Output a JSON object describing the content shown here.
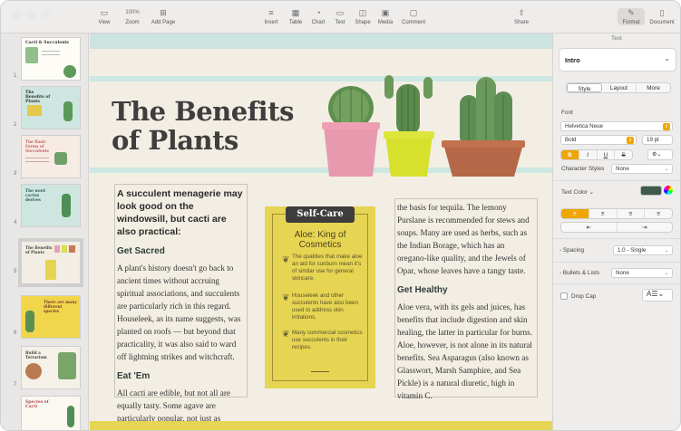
{
  "toolbar": {
    "view": "View",
    "zoom_value": "100%",
    "zoom": "Zoom",
    "add_page": "Add Page",
    "insert": "Insert",
    "table": "Table",
    "chart": "Chart",
    "text": "Text",
    "shape": "Shape",
    "media": "Media",
    "comment": "Comment",
    "share": "Share",
    "format": "Format",
    "document": "Document"
  },
  "sidebar": {
    "thumbnails": [
      {
        "num": "1",
        "title": "Cacti & Succulents"
      },
      {
        "num": "2",
        "title": "The Benefits of Plants"
      },
      {
        "num": "3",
        "title": "The Basic Forms of Succulents"
      },
      {
        "num": "4",
        "title": "The word cactus derives"
      },
      {
        "num": "5",
        "title": "The Benefits of Plants"
      },
      {
        "num": "6",
        "title": "There are many different species"
      },
      {
        "num": "7",
        "title": "Build a Terrarium"
      },
      {
        "num": "8",
        "title": "Species of Cacti"
      }
    ]
  },
  "page": {
    "title_line1": "The Benefits",
    "title_line2": "of Plants",
    "lead": "A succulent menagerie may look good on the windowsill, but cacti are also practical:",
    "h_sacred": "Get Sacred",
    "p_sacred": "A plant's history doesn't go back to ancient times without accruing spiritual associations, and succulents are particularly rich in this regard. Houseleek, as its name suggests, was planted on roofs — but beyond that practicality, it was also said to ward off lightning strikes and witchcraft.",
    "h_eat": "Eat 'Em",
    "p_eat": "All cacti are edible, but not all are equally tasty. Some agave are particularly popular, not just as ingredients in cooking but as",
    "selfcare_badge": "Self-Care",
    "selfcare_title": "Aloe: King of Cosmetics",
    "selfcare_items": [
      "The qualities that make aloe an aid for sunburn mean it's of similar use for general skincare.",
      "Houseleek and other succulents have also been used to address skin irritations.",
      "Many commercial cosmetics use succulents in their recipes."
    ],
    "p_right1": "the basis for tequila. The lemony Purslane is recommended for stews and soups. Many are used as herbs, such as the Indian Borage, which has an oregano-like quality, and the Jewels of Opar, whose leaves have a tangy taste.",
    "h_healthy": "Get Healthy",
    "p_healthy": "Aloe vera, with its gels and juices, has benefits that include digestion and skin healing, the latter in particular for burns. Aloe, however, is not alone in its natural benefits. Sea Asparagus (also known as Glasswort, Marsh Samphire, and Sea Pickle) is a natural diuretic, high in vitamin C."
  },
  "inspector": {
    "header": "Text",
    "style_name": "Intro",
    "tabs": [
      "Style",
      "Layout",
      "More"
    ],
    "font_label": "Font",
    "font_name": "Helvetica Neue",
    "font_weight": "Bold",
    "font_size": "19 pt",
    "styles": [
      "B",
      "I",
      "U",
      "S"
    ],
    "char_styles_label": "Character Styles",
    "char_styles_value": "None",
    "text_color_label": "Text Color",
    "spacing_label": "Spacing",
    "spacing_value": "1.0 - Single",
    "bullets_label": "Bullets & Lists",
    "bullets_value": "None",
    "dropcap_label": "Drop Cap",
    "text_color": "#3f5a4a",
    "accent": "#f0a500"
  }
}
